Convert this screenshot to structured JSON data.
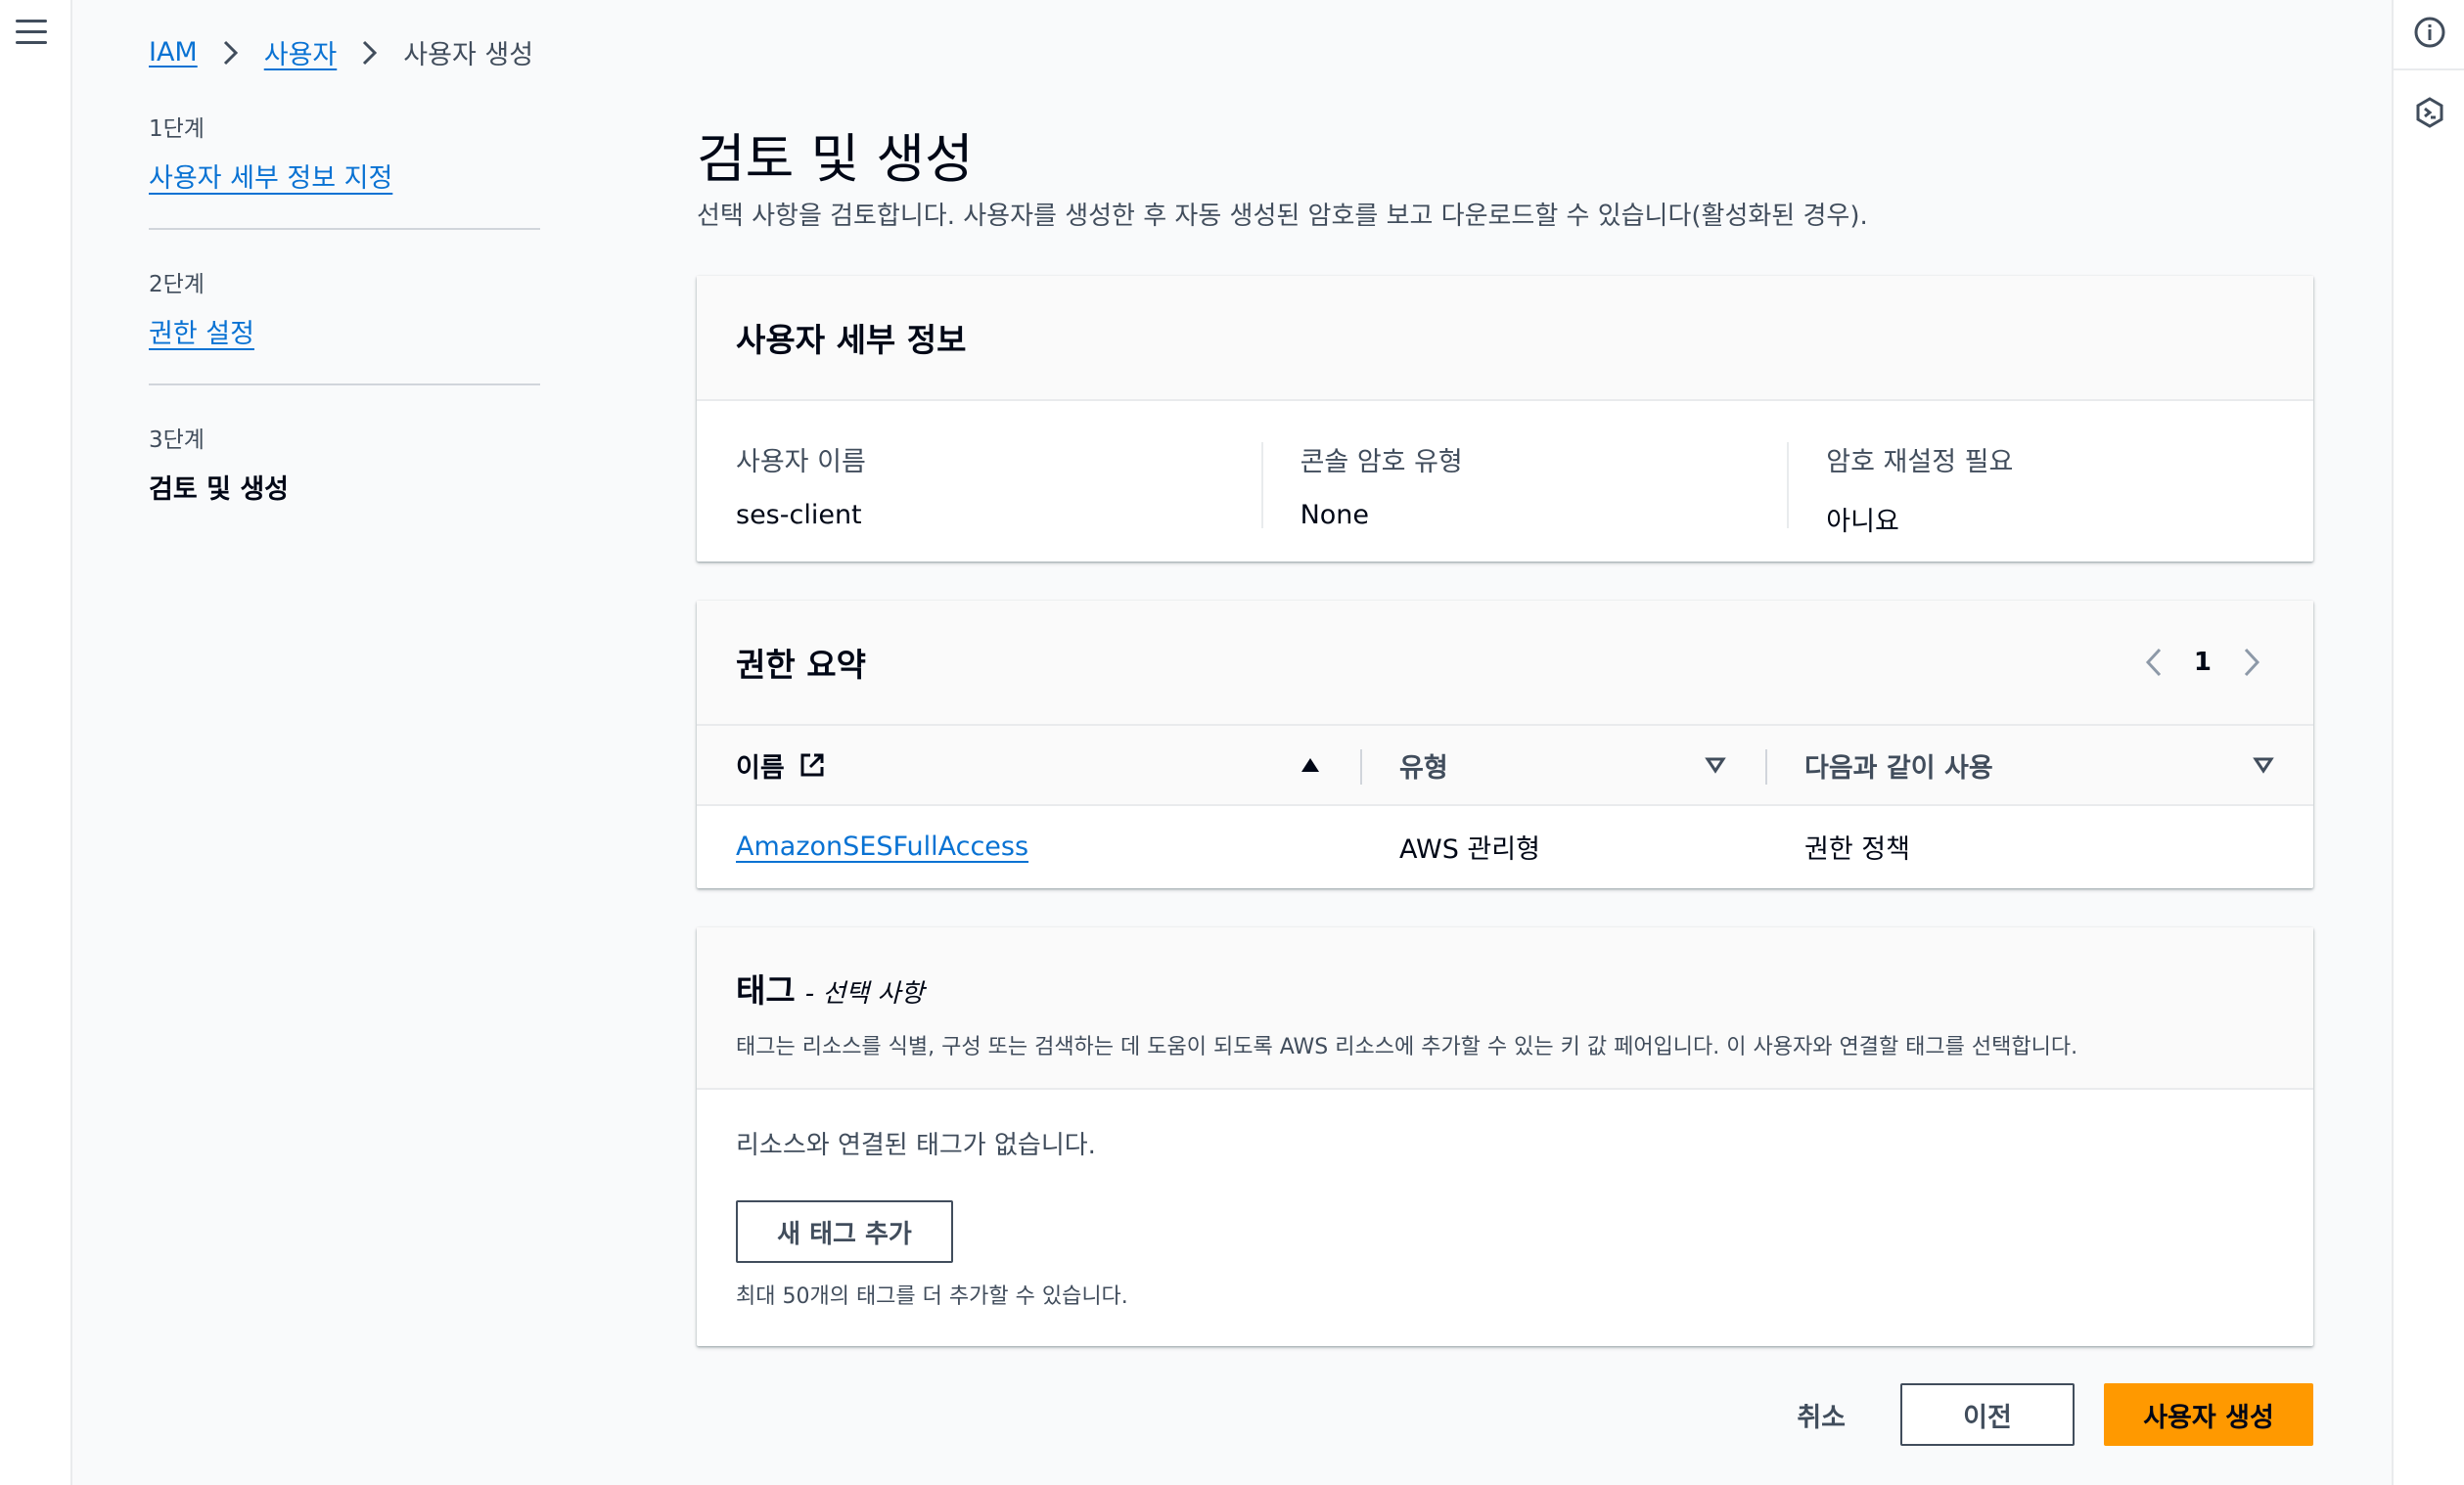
{
  "breadcrumb": {
    "iam": "IAM",
    "users": "사용자",
    "current": "사용자 생성"
  },
  "steps": [
    {
      "number": "1단계",
      "label": "사용자 세부 정보 지정"
    },
    {
      "number": "2단계",
      "label": "권한 설정"
    },
    {
      "number": "3단계",
      "label": "검토 및 생성"
    }
  ],
  "page": {
    "title": "검토 및 생성",
    "description": "선택 사항을 검토합니다. 사용자를 생성한 후 자동 생성된 암호를 보고 다운로드할 수 있습니다(활성화된 경우)."
  },
  "user_details": {
    "title": "사용자 세부 정보",
    "fields": [
      {
        "label": "사용자 이름",
        "value": "ses-client"
      },
      {
        "label": "콘솔 암호 유형",
        "value": "None"
      },
      {
        "label": "암호 재설정 필요",
        "value": "아니요"
      }
    ]
  },
  "permissions": {
    "title": "권한 요약",
    "page_number": "1",
    "columns": {
      "name": "이름",
      "type": "유형",
      "used_as": "다음과 같이 사용"
    },
    "rows": [
      {
        "name": "AmazonSESFullAccess",
        "type": "AWS 관리형",
        "used_as": "권한 정책"
      }
    ]
  },
  "tags": {
    "title": "태그",
    "optional": "- 선택 사항",
    "description": "태그는 리소스를 식별, 구성 또는 검색하는 데 도움이 되도록 AWS 리소스에 추가할 수 있는 키 값 페어입니다. 이 사용자와 연결할 태그를 선택합니다.",
    "empty": "리소스와 연결된 태그가 없습니다.",
    "add_button": "새 태그 추가",
    "hint": "최대 50개의 태그를 더 추가할 수 있습니다."
  },
  "actions": {
    "cancel": "취소",
    "previous": "이전",
    "create": "사용자 생성"
  },
  "colors": {
    "link": "#0972d3",
    "primary": "#ff9900",
    "text": "#000716",
    "muted": "#414d5c"
  },
  "icons": {
    "menu": "hamburger-menu-icon",
    "info": "info-icon",
    "notifications": "cloudshell-hexagon-icon",
    "external": "external-link-icon",
    "sort_asc": "sort-ascending-icon",
    "sort": "sort-icon"
  }
}
